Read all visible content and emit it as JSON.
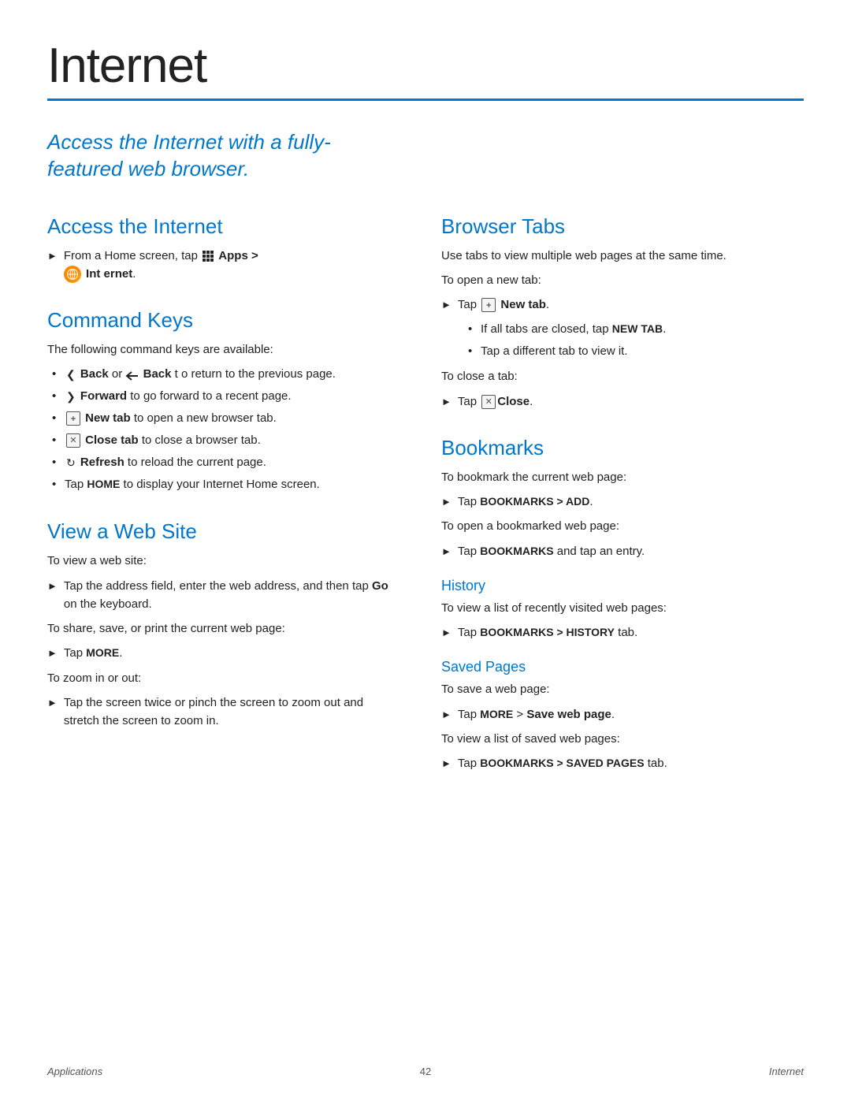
{
  "page": {
    "title": "Internet",
    "tagline": "Access the Internet with a fully-featured web browser.",
    "footer_left": "Applications",
    "footer_center": "42",
    "footer_right": "Internet"
  },
  "left_col": {
    "section1": {
      "title": "Access the Internet",
      "step1": "From a Home screen, tap",
      "step1_apps": "Apps >",
      "step1_internet": "Int ernet."
    },
    "section2": {
      "title": "Command Keys",
      "intro": "The following command keys are available:",
      "items": [
        "Back or  Back t o return to the previous page.",
        "Forward to go forward to a recent page.",
        " New tab to open a new browser tab.",
        " Close tab to close a browser tab.",
        " Refresh to reload the current page.",
        "Tap HOME to display your Internet Home screen."
      ]
    },
    "section3": {
      "title": "View a Web Site",
      "intro1": "To view a web site:",
      "step1": "Tap the address field, enter the web address, and then tap Go on the keyboard.",
      "intro2": "To share, save, or print the current web page:",
      "step2": "Tap MORE.",
      "intro3": "To zoom in or out:",
      "step3": "Tap the screen twice or pinch the screen to zoom out and stretch the screen to zoom in."
    }
  },
  "right_col": {
    "section1": {
      "title": "Browser Tabs",
      "intro": "Use tabs to view multiple web pages at the same time.",
      "open_tab_label": "To open a new tab:",
      "open_step": "Tap  New tab.",
      "sub_bullets": [
        "If all tabs are closed, tap NEW TAB.",
        "Tap a different tab to view it."
      ],
      "close_tab_label": "To close a tab:",
      "close_step": "Tap  Close."
    },
    "section2": {
      "title": "Bookmarks",
      "bookmark_intro": "To bookmark the current web page:",
      "bookmark_step": "Tap BOOKMARKS > ADD.",
      "open_intro": "To open a bookmarked web page:",
      "open_step": "Tap BOOKMARKS and tap an entry.",
      "history": {
        "title": "History",
        "intro": "To view a list of recently visited web pages:",
        "step": "Tap BOOKMARKS > HISTORY tab."
      },
      "saved_pages": {
        "title": "Saved Pages",
        "intro": "To save a web page:",
        "step": "Tap MORE > Save web page.",
        "intro2": "To view a list of saved web pages:",
        "step2": "Tap BOOKMARKS > SAVED PAGES tab."
      }
    }
  }
}
